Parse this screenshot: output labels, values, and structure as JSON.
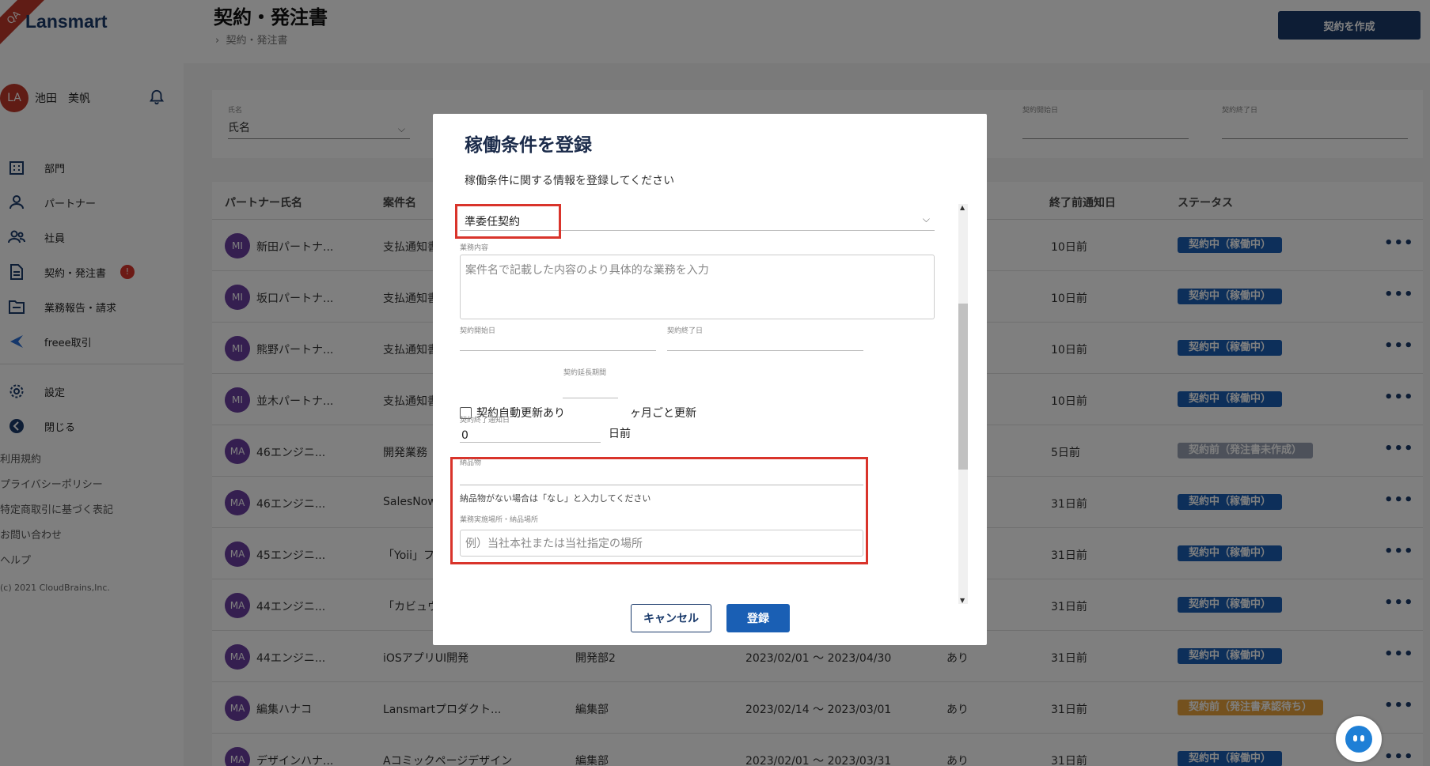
{
  "sidebar": {
    "ribbon": "QA",
    "logo": "Lansmart",
    "user": {
      "initials": "LA",
      "name": "池田　美帆"
    },
    "nav": [
      {
        "label": "部門",
        "icon": "building-icon"
      },
      {
        "label": "パートナー",
        "icon": "person-icon"
      },
      {
        "label": "社員",
        "icon": "people-icon"
      },
      {
        "label": "契約・発注書",
        "icon": "document-icon",
        "badge": "!"
      },
      {
        "label": "業務報告・請求",
        "icon": "folder-icon"
      },
      {
        "label": "freee取引",
        "icon": "freee-icon"
      },
      {
        "label": "設定",
        "icon": "gear-icon"
      },
      {
        "label": "閉じる",
        "icon": "collapse-icon"
      }
    ],
    "footer_links": [
      "利用規約",
      "プライバシーポリシー",
      "特定商取引に基づく表記",
      "お問い合わせ",
      "ヘルプ"
    ],
    "copyright": "(c) 2021 CloudBrains,Inc."
  },
  "header": {
    "title": "契約・発注書",
    "breadcrumb": "契約・発注書",
    "create_button": "契約を作成"
  },
  "filters": [
    {
      "label": "氏名",
      "value": "氏名",
      "has_dropdown": true
    },
    {
      "label": "契約開始日",
      "value": ""
    },
    {
      "label": "契約終了日",
      "value": ""
    }
  ],
  "table": {
    "headers": [
      "パートナー氏名",
      "案件名",
      "終了前通知日",
      "ステータス"
    ],
    "rows": [
      {
        "initials": "MI",
        "name": "新田パートナ...",
        "project": "支払通知書",
        "dept": "",
        "period": "",
        "renew": "",
        "notice": "10日前",
        "status": "契約中（稼働中）",
        "status_color": "#1a5fb4"
      },
      {
        "initials": "MI",
        "name": "坂口パートナ...",
        "project": "支払通知書",
        "dept": "",
        "period": "",
        "renew": "",
        "notice": "10日前",
        "status": "契約中（稼働中）",
        "status_color": "#1a5fb4"
      },
      {
        "initials": "MI",
        "name": "熊野パートナ...",
        "project": "支払通知書",
        "dept": "",
        "period": "",
        "renew": "",
        "notice": "10日前",
        "status": "契約中（稼働中）",
        "status_color": "#1a5fb4"
      },
      {
        "initials": "MI",
        "name": "並木パートナ...",
        "project": "支払通知書",
        "dept": "",
        "period": "",
        "renew": "",
        "notice": "10日前",
        "status": "契約中（稼働中）",
        "status_color": "#1a5fb4"
      },
      {
        "initials": "MA",
        "name": "46エンジニ...",
        "project": "開発業務",
        "dept": "",
        "period": "",
        "renew": "",
        "notice": "5日前",
        "status": "契約前（発注書未作成）",
        "status_color": "#9aa3b5"
      },
      {
        "initials": "MA",
        "name": "46エンジニ...",
        "project": "SalesNow",
        "dept": "",
        "period": "",
        "renew": "",
        "notice": "31日前",
        "status": "契約中（稼働中）",
        "status_color": "#1a5fb4"
      },
      {
        "initials": "MA",
        "name": "45エンジニ...",
        "project": "「Yoii」フ",
        "dept": "",
        "period": "",
        "renew": "",
        "notice": "31日前",
        "status": "契約中（稼働中）",
        "status_color": "#1a5fb4"
      },
      {
        "initials": "MA",
        "name": "44エンジニ...",
        "project": "「カビュウ",
        "dept": "",
        "period": "",
        "renew": "",
        "notice": "31日前",
        "status": "契約中（稼働中）",
        "status_color": "#1a5fb4"
      },
      {
        "initials": "MA",
        "name": "44エンジニ...",
        "project": "iOSアプリUI開発",
        "dept": "開発部2",
        "period": "2023/02/01 ～ 2023/04/30",
        "renew": "あり",
        "notice": "31日前",
        "status": "契約中（稼働中）",
        "status_color": "#1a5fb4"
      },
      {
        "initials": "MA",
        "name": "編集ハナコ",
        "project": "Lansmartプロダクト...",
        "dept": "編集部",
        "period": "2023/02/14 ～ 2023/03/01",
        "renew": "あり",
        "notice": "31日前",
        "status": "契約前（発注書承認待ち）",
        "status_color": "#e8a33c"
      },
      {
        "initials": "MA",
        "name": "デザインハナ...",
        "project": "Aコミックページデザイン",
        "dept": "編集部",
        "period": "2023/02/01 ～ 2023/03/31",
        "renew": "あり",
        "notice": "31日前",
        "status": "契約中（稼働中）",
        "status_color": "#1a5fb4"
      }
    ]
  },
  "modal": {
    "title": "稼働条件を登録",
    "subtitle": "稼働条件に関する情報を登録してください",
    "contract_type": "準委任契約",
    "work_content_label": "業務内容",
    "work_content_placeholder": "案件名で記載した内容のより具体的な業務を入力",
    "start_label": "契約開始日",
    "end_label": "契約終了日",
    "auto_renew_label": "契約自動更新あり",
    "extension_label": "契約延長期間",
    "extension_suffix": "ヶ月ごと更新",
    "notice_label": "契約終了通知日",
    "notice_value": "0",
    "notice_suffix": "日前",
    "deliverable_label": "納品物",
    "deliverable_hint": "納品物がない場合は「なし」と入力してください",
    "location_label": "業務実施場所・納品場所",
    "location_placeholder": "例）当社本社または当社指定の場所",
    "cancel": "キャンセル",
    "save": "登録"
  }
}
